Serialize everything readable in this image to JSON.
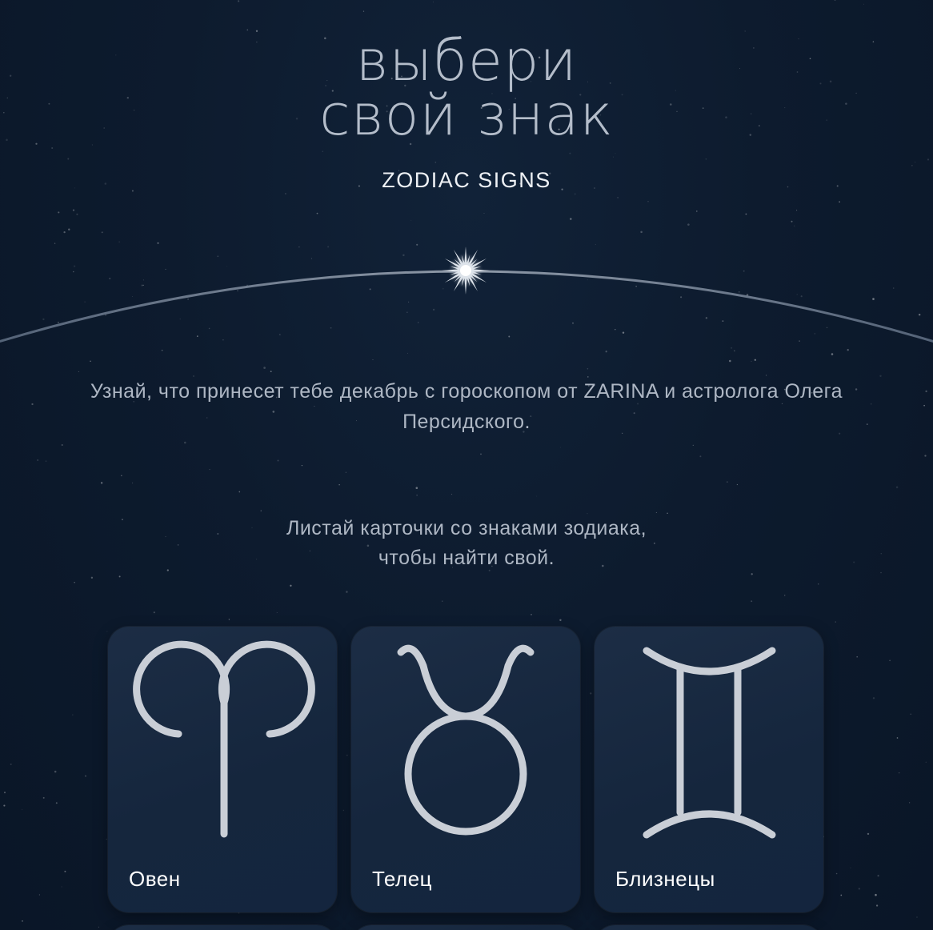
{
  "header": {
    "title_line1": "выбери",
    "title_line2": "свой знак",
    "subtitle": "ZODIAC SIGNS"
  },
  "intro": {
    "line1": "Узнай, что принесет тебе декабрь с гороскопом от ZARINA и астролога Олега",
    "line2": "Персидского."
  },
  "hint": {
    "line1": "Листай карточки со знаками зодиака,",
    "line2": "чтобы найти свой."
  },
  "cards": [
    {
      "label": "Овен",
      "icon": "aries-icon"
    },
    {
      "label": "Телец",
      "icon": "taurus-icon"
    },
    {
      "label": "Близнецы",
      "icon": "gemini-icon"
    }
  ],
  "colors": {
    "background": "#0c1a2c",
    "card": "#172840",
    "glyph": "#c9ced6",
    "title": "#b4bdca"
  }
}
